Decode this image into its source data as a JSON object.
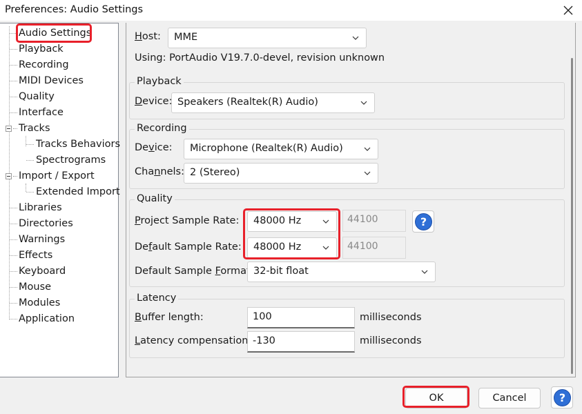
{
  "window": {
    "title": "Preferences: Audio Settings"
  },
  "tree": {
    "items": [
      {
        "label": "Audio Settings"
      },
      {
        "label": "Playback"
      },
      {
        "label": "Recording"
      },
      {
        "label": "MIDI Devices"
      },
      {
        "label": "Quality"
      },
      {
        "label": "Interface"
      },
      {
        "label": "Tracks"
      },
      {
        "label": "Tracks Behaviors"
      },
      {
        "label": "Spectrograms"
      },
      {
        "label": "Import / Export"
      },
      {
        "label": "Extended Import"
      },
      {
        "label": "Libraries"
      },
      {
        "label": "Directories"
      },
      {
        "label": "Warnings"
      },
      {
        "label": "Effects"
      },
      {
        "label": "Keyboard"
      },
      {
        "label": "Mouse"
      },
      {
        "label": "Modules"
      },
      {
        "label": "Application"
      }
    ]
  },
  "host": {
    "label_prefix": "H",
    "label_rest": "ost:",
    "value": "MME",
    "using_text": "Using: PortAudio V19.7.0-devel, revision unknown"
  },
  "playback": {
    "group_label": "Playback",
    "device_label_prefix": "D",
    "device_label_rest": "evice:",
    "device_value": "Speakers (Realtek(R) Audio)"
  },
  "recording": {
    "group_label": "Recording",
    "device_label_a": "De",
    "device_label_u": "v",
    "device_label_b": "ice:",
    "device_value": "Microphone (Realtek(R) Audio)",
    "channels_label_a": "Cha",
    "channels_label_u": "n",
    "channels_label_b": "nels:",
    "channels_value": "2 (Stereo)"
  },
  "quality": {
    "group_label": "Quality",
    "project_rate_label_u": "P",
    "project_rate_label_rest": "roject Sample Rate:",
    "project_rate_value": "48000 Hz",
    "project_rate_other": "44100",
    "default_rate_label_a": "De",
    "default_rate_label_u": "f",
    "default_rate_label_b": "ault Sample Rate:",
    "default_rate_value": "48000 Hz",
    "default_rate_other": "44100",
    "format_label_a": "Default Sample ",
    "format_label_u": "F",
    "format_label_b": "ormat:",
    "format_value": "32-bit float"
  },
  "latency": {
    "group_label": "Latency",
    "buffer_label_u": "B",
    "buffer_label_rest": "uffer length:",
    "buffer_value": "100",
    "buffer_unit": "milliseconds",
    "comp_label_u": "L",
    "comp_label_rest": "atency compensation:",
    "comp_value": "-130",
    "comp_unit": "milliseconds"
  },
  "buttons": {
    "ok": "OK",
    "cancel": "Cancel",
    "help": "?"
  },
  "colors": {
    "highlight": "#e8202a",
    "help_blue": "#2f6fd6"
  }
}
